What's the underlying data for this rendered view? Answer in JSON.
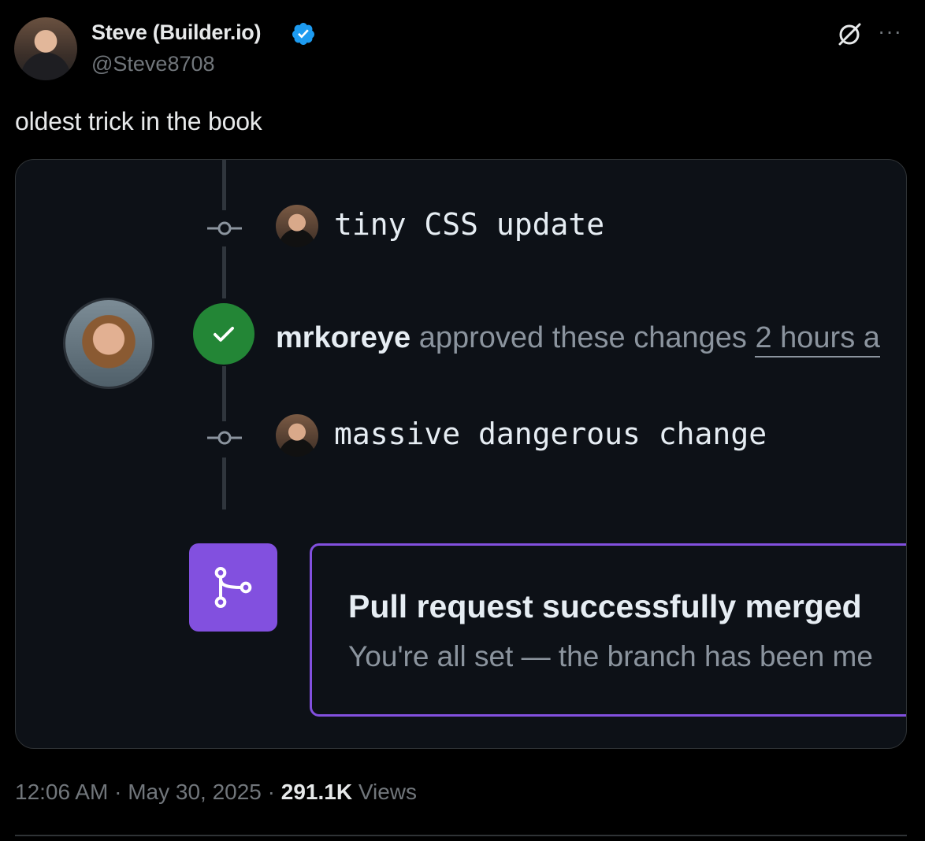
{
  "author": {
    "name": "Steve (Builder.io)",
    "handle": "@Steve8708",
    "verified_color": "#1d9bf0"
  },
  "header_icons": [
    "grok-icon",
    "more-icon"
  ],
  "more_glyph": "···",
  "tweet": {
    "text": "oldest trick in the book"
  },
  "media": {
    "commits": [
      {
        "message": "tiny CSS update"
      },
      {
        "message": "massive dangerous change"
      }
    ],
    "review": {
      "user": "mrkoreye",
      "action": "approved these changes",
      "time": "2 hours a"
    },
    "merge": {
      "title": "Pull request successfully merged",
      "subtitle": "You're all set — the branch has been me",
      "accent": "#8250df"
    },
    "check_color": "#238636"
  },
  "meta": {
    "time": "12:06 AM",
    "sep": "·",
    "date": "May 30, 2025",
    "views_count": "291.1K",
    "views_label": "Views"
  }
}
